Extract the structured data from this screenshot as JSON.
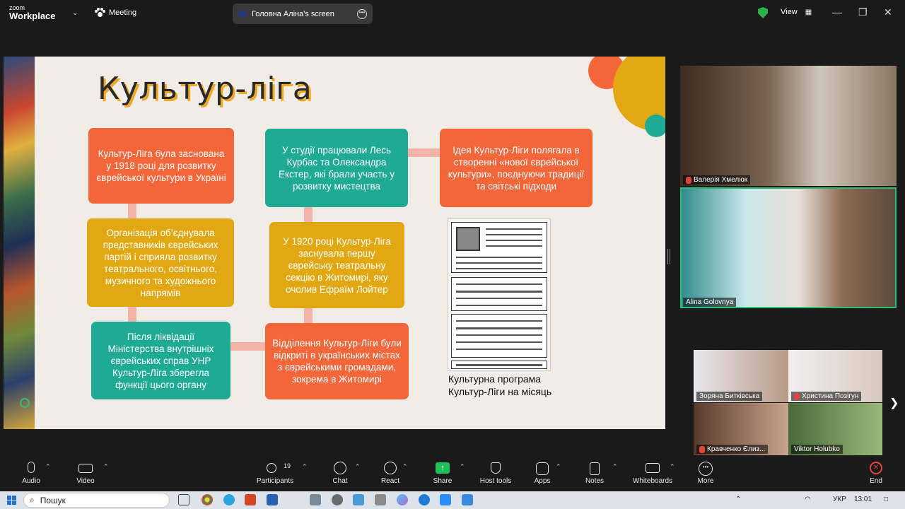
{
  "topbar": {
    "brand_line1": "zoom",
    "brand_line2": "Workplace",
    "meeting_label": "Meeting",
    "shared_screen_label": "Головна Аліна's screen",
    "view_label": "View",
    "min_icon": "minimize-icon",
    "max_icon": "maximize-icon",
    "close_icon": "close-icon"
  },
  "slide": {
    "title": "Культур-ліга",
    "boxes": [
      {
        "id": "b1",
        "color": "orange",
        "text": "Культур-Ліга була заснована у 1918 році для розвитку єврейської культури в Україні"
      },
      {
        "id": "b2",
        "color": "teal",
        "text": "У студії працювали Лесь Курбас та Олександра Екстер, які брали участь у розвитку мистецтва"
      },
      {
        "id": "b3",
        "color": "orange",
        "text": "Ідея Культур-Ліги полягала в створенні «нової єврейської культури», поєднуючи традиції та світські підходи"
      },
      {
        "id": "b4",
        "color": "yellow",
        "text": "Організація об’єднувала представників єврейських партій і сприяла розвитку театрального, освітнього, музичного та художнього напрямів"
      },
      {
        "id": "b5",
        "color": "yellow",
        "text": "У 1920 році Культур-Ліга заснувала першу єврейську театральну секцію в Житомирі, яку очолив Ефраїм Лойтер"
      },
      {
        "id": "b6",
        "color": "teal",
        "text": "Після ліквідації Міністерства внутрішніх єврейських справ УНР Культур-Ліга зберегла функції цього органу"
      },
      {
        "id": "b7",
        "color": "orange",
        "text": "Відділення Культур-Ліги були відкриті в українських містах з єврейськими громадами, зокрема в Житомирі"
      }
    ],
    "caption_line1": "Культурна програма",
    "caption_line2": "Культур-Ліги на місяць",
    "colors": {
      "orange": "#f2663a",
      "yellow": "#e1a813",
      "teal": "#1faa96",
      "connector": "#f2b3a8"
    }
  },
  "participants": [
    {
      "name": "Валерія  Хмелюк",
      "muted": true
    },
    {
      "name": "Alina Golovnya",
      "muted": false,
      "active": true
    },
    {
      "name": "Зоряна Битківська",
      "muted": false
    },
    {
      "name": "Христина Позігун",
      "muted": true
    },
    {
      "name": "Кравченко Єлиз...",
      "muted": true
    },
    {
      "name": "Viktor Holubko",
      "muted": false
    }
  ],
  "toolbar": {
    "audio": "Audio",
    "video": "Video",
    "participants": "Participants",
    "participants_count": "19",
    "chat": "Chat",
    "react": "React",
    "share": "Share",
    "host_tools": "Host tools",
    "apps": "Apps",
    "notes": "Notes",
    "whiteboards": "Whiteboards",
    "more": "More",
    "end": "End"
  },
  "taskbar": {
    "search_placeholder": "Пошук",
    "language": "УКР",
    "time": "13:01"
  }
}
